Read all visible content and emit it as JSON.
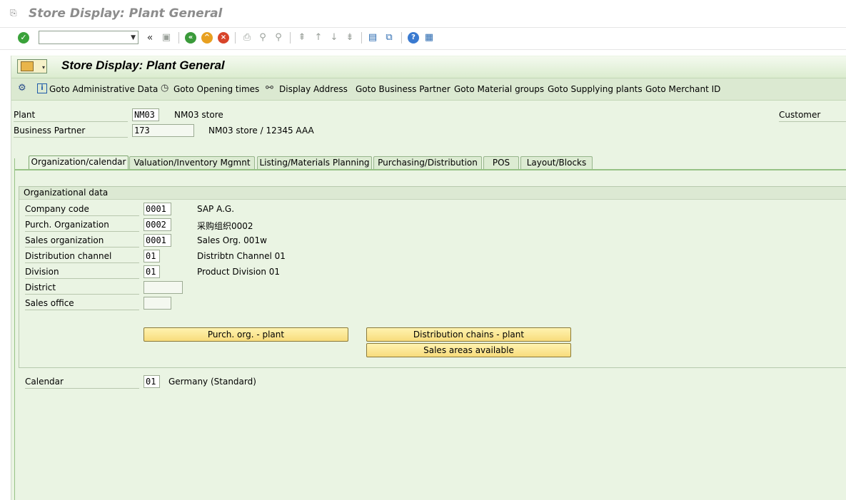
{
  "window": {
    "title": "Store Display: Plant General"
  },
  "systoolbar": {
    "command_value": ""
  },
  "app": {
    "title": "Store Display: Plant General",
    "toolbar": [
      "Goto Administrative Data",
      "Goto Opening times",
      "Display Address",
      "Goto Business Partner",
      "Goto Material groups",
      "Goto Supplying plants",
      "Goto Merchant ID"
    ]
  },
  "header": {
    "plant_label": "Plant",
    "plant_value": "NM03",
    "plant_desc": "NM03 store",
    "bp_label": "Business Partner",
    "bp_value": "173",
    "bp_desc": "NM03 store / 12345 AAA",
    "customer_label": "Customer"
  },
  "tabs": [
    "Organization/calendar",
    "Valuation/Inventory Mgmnt",
    "Listing/Materials Planning",
    "Purchasing/Distribution",
    "POS",
    "Layout/Blocks"
  ],
  "org": {
    "group_title": "Organizational data",
    "rows": [
      {
        "label": "Company code",
        "value": "0001",
        "desc": "SAP A.G."
      },
      {
        "label": "Purch. Organization",
        "value": "0002",
        "desc": "采购组织0002"
      },
      {
        "label": "Sales organization",
        "value": "0001",
        "desc": "Sales Org. 001w"
      },
      {
        "label": "Distribution channel",
        "value": "01",
        "desc": "Distribtn Channel 01"
      },
      {
        "label": "Division",
        "value": "01",
        "desc": "Product Division 01"
      },
      {
        "label": "District",
        "value": "",
        "desc": ""
      },
      {
        "label": "Sales office",
        "value": "",
        "desc": ""
      }
    ],
    "buttons": {
      "purch_org_plant": "Purch. org. - plant",
      "dist_chains_plant": "Distribution chains - plant",
      "sales_areas": "Sales areas available"
    }
  },
  "calendar": {
    "label": "Calendar",
    "value": "01",
    "desc": "Germany (Standard)"
  },
  "colors": {
    "background": "#eaf4e3",
    "tab_line": "#97c286",
    "button": "#f8dc7c"
  }
}
